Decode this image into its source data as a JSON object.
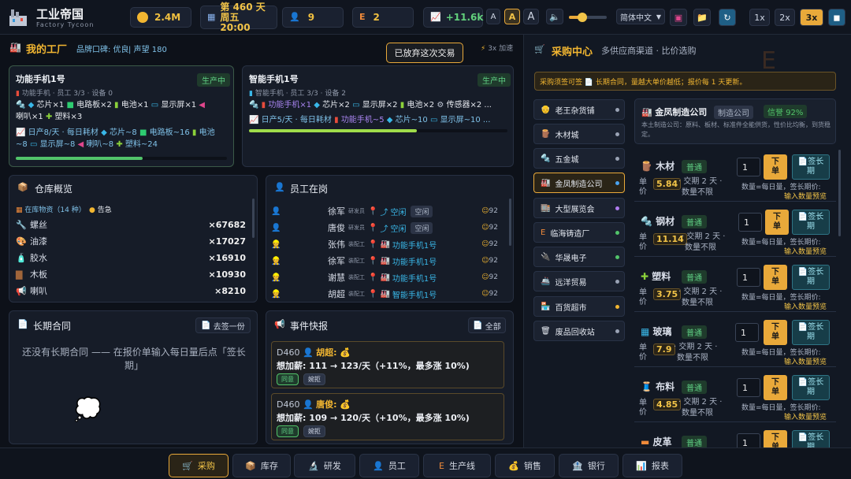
{
  "header": {
    "title": "工业帝国",
    "subtitle": "Factory Tycoon",
    "money": "2.4M",
    "day_line1": "第 460 天",
    "day_line2": "周五 20:00",
    "workers": "9",
    "lines": "2",
    "income": "+11.6k",
    "font_small": "A",
    "font_mid": "A",
    "font_big": "A",
    "language": "简体中文",
    "speed_1x": "1x",
    "speed_2x": "2x",
    "speed_3x": "3x"
  },
  "factory": {
    "title": "我的工厂",
    "brand": "品牌口碑: 优良",
    "fame": "| 声望 180",
    "toast": "已放弃这次交易",
    "speed_note": "3x 加速",
    "lines": [
      {
        "name": "功能手机1号",
        "status": "生产中",
        "meta": "功能手机 · 员工 3/3 · 设备 0",
        "parts_a": "芯片×1",
        "parts_b": "电路板×2",
        "parts_c": "电池×1",
        "parts_d": "显示屏×1",
        "parts_e": "喇叭×1",
        "parts_f": "塑料×3",
        "daily": "日产8/天 · 每日耗材",
        "use_a": "芯片~8",
        "use_b": "电路板~16",
        "use_c": "电池",
        "use_d": "~8",
        "use_e": "显示屏~8",
        "use_f": "喇叭~8",
        "use_g": "塑料~24",
        "progress": 0.6
      },
      {
        "name": "智能手机1号",
        "status": "生产中",
        "meta": "智能手机 · 员工 3/3 · 设备 2",
        "parts_a": "功能手机×1",
        "parts_b": "芯片×2",
        "parts_c": "显示屏×2",
        "parts_d": "电池×2",
        "parts_e": "传感器×2 ...",
        "daily": "日产5/天 · 每日耗材",
        "use_a": "功能手机~5",
        "use_b": "芯片~10",
        "use_c": "显示屏~10 ...",
        "progress": 0.65
      }
    ]
  },
  "warehouse": {
    "title": "仓库概览",
    "stock_label": "在库物资（14 种）",
    "alert": "告急",
    "items": [
      {
        "name": "螺丝",
        "qty": "×67682"
      },
      {
        "name": "油漆",
        "qty": "×17027"
      },
      {
        "name": "胶水",
        "qty": "×16910"
      },
      {
        "name": "木板",
        "qty": "×10930"
      },
      {
        "name": "喇叭",
        "qty": "×8210"
      }
    ]
  },
  "staff": {
    "title": "员工在岗",
    "rows": [
      {
        "name": "徐军",
        "role": "研发员",
        "task": "空闲",
        "state": "空闲",
        "mood": "92"
      },
      {
        "name": "唐俊",
        "role": "研发员",
        "task": "空闲",
        "state": "空闲",
        "mood": "92"
      },
      {
        "name": "张伟",
        "role": "装配工",
        "task": "功能手机1号",
        "state": "",
        "mood": "92"
      },
      {
        "name": "徐军",
        "role": "装配工",
        "task": "功能手机1号",
        "state": "",
        "mood": "92"
      },
      {
        "name": "谢慧",
        "role": "装配工",
        "task": "功能手机1号",
        "state": "",
        "mood": "92"
      },
      {
        "name": "胡超",
        "role": "装配工",
        "task": "智能手机1号",
        "state": "",
        "mood": "92"
      }
    ]
  },
  "contracts": {
    "title": "长期合同",
    "button": "去签一份",
    "empty_text": "还没有长期合同 —— 在报价单输入每日量后点「签长期」"
  },
  "events": {
    "title": "事件快报",
    "all_button": "全部",
    "items": [
      {
        "day": "D460",
        "who": "胡超:",
        "text": "想加薪: 111 → 123/天（+11%，最多涨 10%)",
        "accept": "同意",
        "reject": "婉拒"
      },
      {
        "day": "D460",
        "who": "唐俊:",
        "text": "想加薪: 109 → 120/天（+10%，最多涨 10%)",
        "accept": "同意",
        "reject": "婉拒"
      }
    ]
  },
  "purchase": {
    "title": "采购中心",
    "subtitle": "多供应商渠道 · 比价选购",
    "notice": "采购须签可签 📄 长期合同，量越大单价越低；报价每 1 天更新。",
    "suppliers": [
      {
        "name": "老王杂货铺",
        "dot": "#9aa3b5"
      },
      {
        "name": "木材城",
        "dot": "#9aa3b5"
      },
      {
        "name": "五金城",
        "dot": "#9aa3b5"
      },
      {
        "name": "金凤制造公司",
        "dot": "#4aa3f0"
      },
      {
        "name": "大型展览会",
        "dot": "#b07cf0"
      },
      {
        "name": "临海铸造厂",
        "dot": "#52c46a"
      },
      {
        "name": "华晟电子",
        "dot": "#52c46a"
      },
      {
        "name": "远洋贸易",
        "dot": "#9aa3b5"
      },
      {
        "name": "百货超市",
        "dot": "#f2b631"
      },
      {
        "name": "废品回收站",
        "dot": "#9aa3b5"
      }
    ],
    "vendor": {
      "name": "金凤制造公司",
      "kind": "制造公司",
      "trust": "信誉 92%",
      "desc": "本土制造公司：原料、板材、标准件全能供货，性价比均衡，到货稳定。"
    },
    "materials": [
      {
        "name": "木材",
        "grade": "普通",
        "price": "5.84",
        "qty": "1"
      },
      {
        "name": "钢材",
        "grade": "普通",
        "price": "11.14",
        "qty": "1"
      },
      {
        "name": "塑料",
        "grade": "普通",
        "price": "3.75",
        "qty": "1"
      },
      {
        "name": "玻璃",
        "grade": "普通",
        "price": "7.9",
        "qty": "1"
      },
      {
        "name": "布料",
        "grade": "普通",
        "price": "4.85",
        "qty": "1"
      },
      {
        "name": "皮革",
        "grade": "普通",
        "price": "",
        "qty": "1"
      }
    ],
    "unit_label": "单价",
    "delivery": "· 交期 2 天 ·",
    "qty_unlimited": "数量不限",
    "buy_label_1": "下",
    "buy_label_2": "单",
    "lt_label_1": "签长",
    "lt_label_2": "期",
    "qty_note": "数量=每日量，签长期价:",
    "qty_preview": "输入数量预览"
  },
  "nav": [
    "采购",
    "库存",
    "研发",
    "员工",
    "生产线",
    "销售",
    "银行",
    "报表"
  ]
}
